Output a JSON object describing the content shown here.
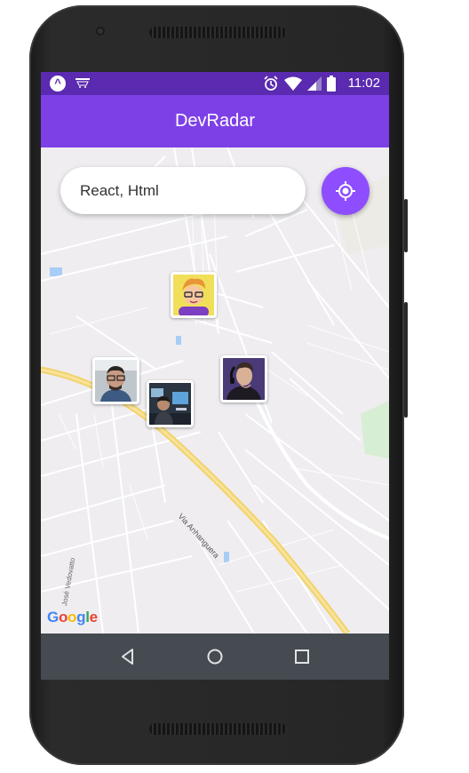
{
  "status_bar": {
    "time": "11:02",
    "icons": [
      "alarm-icon",
      "wifi-icon",
      "signal-icon",
      "battery-icon"
    ]
  },
  "app_bar": {
    "title": "DevRadar"
  },
  "search": {
    "value": "React, Html"
  },
  "map": {
    "road_label_1": "Via Anhanguera",
    "road_label_2": "José Vedovatto",
    "attribution": [
      "G",
      "o",
      "o",
      "g",
      "l",
      "e"
    ]
  },
  "colors": {
    "status_bar": "#5a2ab0",
    "app_bar": "#7d40e7",
    "accent": "#8e4dff",
    "nav_bar": "#464b52"
  },
  "markers": [
    {
      "name": "dev-avatar-cartoon"
    },
    {
      "name": "dev-avatar-glasses"
    },
    {
      "name": "dev-avatar-desk"
    },
    {
      "name": "dev-avatar-headphones"
    }
  ]
}
